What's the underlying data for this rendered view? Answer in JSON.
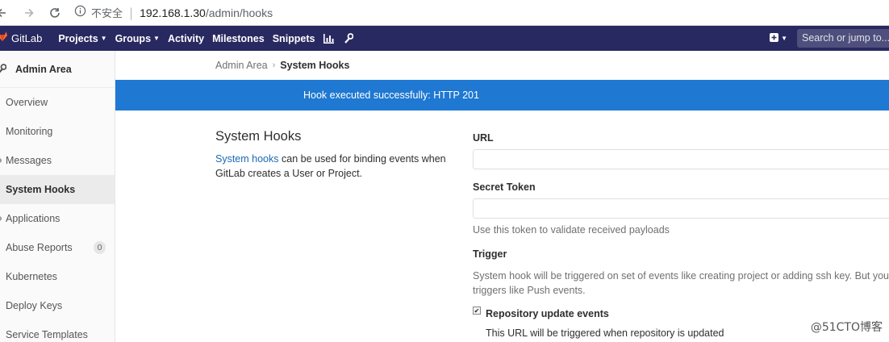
{
  "browser": {
    "insecure_label": "不安全",
    "url_host": "192.168.1.30",
    "url_path": "/admin/hooks"
  },
  "navbar": {
    "brand": "GitLab",
    "items": [
      "Projects",
      "Groups",
      "Activity",
      "Milestones",
      "Snippets"
    ],
    "search_placeholder": "Search or jump to..."
  },
  "sidebar": {
    "header": "Admin Area",
    "items": [
      {
        "label": "Overview"
      },
      {
        "label": "Monitoring"
      },
      {
        "label": "Messages"
      },
      {
        "label": "System Hooks"
      },
      {
        "label": "Applications"
      },
      {
        "label": "Abuse Reports",
        "badge": "0"
      },
      {
        "label": "Kubernetes"
      },
      {
        "label": "Deploy Keys"
      },
      {
        "label": "Service Templates"
      }
    ],
    "active_index": 3
  },
  "breadcrumb": {
    "parent": "Admin Area",
    "current": "System Hooks"
  },
  "flash": {
    "message": "Hook executed successfully: HTTP 201",
    "color": "#1f78d1"
  },
  "intro": {
    "title": "System Hooks",
    "link_text": "System hooks",
    "desc_rest": " can be used for binding events when GitLab creates a User or Project."
  },
  "form": {
    "url_label": "URL",
    "url_value": "",
    "token_label": "Secret Token",
    "token_value": "",
    "token_help": "Use this token to validate received payloads",
    "trigger_label": "Trigger",
    "trigger_help_1": "System hook will be triggered on set of events like creating project or adding ssh key. But you can",
    "trigger_help_2": "triggers like Push events.",
    "repo_update_label": "Repository update events",
    "repo_update_checked": true,
    "repo_update_help": "This URL will be triggered when repository is updated"
  },
  "watermark": "@51CTO博客",
  "colors": {
    "navbar": "#292961",
    "link": "#1b69b6"
  }
}
